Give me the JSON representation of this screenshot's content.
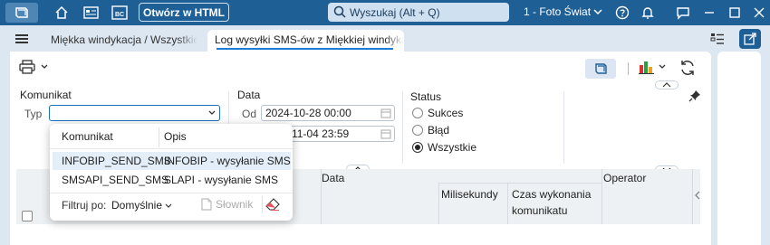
{
  "titlebar": {
    "open_html_label": "Otwórz w HTML",
    "search_placeholder": "Wyszukaj (Alt + Q)",
    "company": "1 - Foto Świat",
    "bc_label": "BC"
  },
  "tabs": [
    {
      "label": "Miękka windykacja / Wszystkie"
    },
    {
      "label": "Log wysyłki SMS-ów z Miękkiej windykacji"
    }
  ],
  "filters": {
    "komunikat": {
      "section_label": "Komunikat",
      "typ_label": "Typ",
      "typ_value": ""
    },
    "data": {
      "section_label": "Data",
      "od_label": "Od",
      "od_value": "2024-10-28 00:00",
      "do_value_visible": "11-04 23:59"
    },
    "status": {
      "section_label": "Status",
      "options": [
        "Sukces",
        "Błąd",
        "Wszystkie"
      ],
      "selected": "Wszystkie"
    }
  },
  "grid": {
    "columns": {
      "data": "Data",
      "operator": "Operator",
      "milisekundy": "Milisekundy",
      "czas_line1": "Czas wykonania",
      "czas_line2": "komunikatu"
    }
  },
  "dropdown": {
    "headers": {
      "komunikat": "Komunikat",
      "opis": "Opis"
    },
    "rows": [
      {
        "komunikat": "INFOBIP_SEND_SMS",
        "opis": "INFOBIP - wysyłanie SMS",
        "selected": true
      },
      {
        "komunikat": "SMSAPI_SEND_SMS",
        "opis": "SLAPI - wysyłanie SMS",
        "selected": false
      }
    ],
    "filter_label": "Filtruj po:",
    "filter_value": "Domyślnie",
    "slownik_label": "Słownik"
  },
  "colors": {
    "titlebar": "#1e5f96",
    "accent": "#1e7cd6",
    "background": "#dde7f1"
  }
}
